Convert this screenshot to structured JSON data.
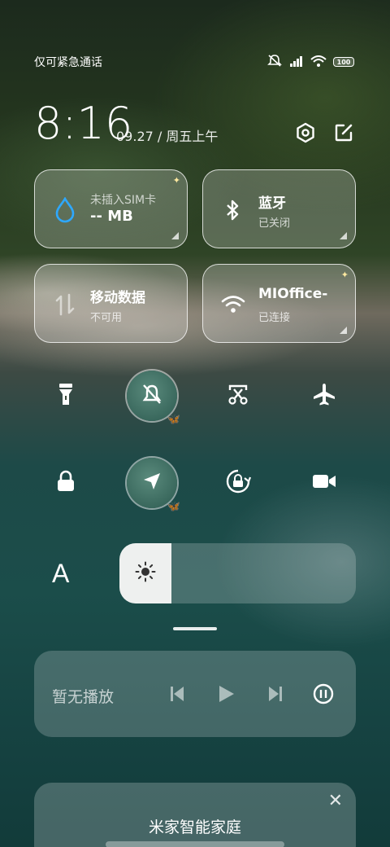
{
  "status_bar": {
    "carrier_text": "仅可紧急通话",
    "battery_level": "100",
    "icons": [
      "silent-icon",
      "signal-icon",
      "wifi-icon",
      "battery-icon"
    ]
  },
  "header": {
    "time": "8:16",
    "date": "09.27 / 周五上午",
    "settings_icon": "gear-icon",
    "edit_icon": "edit-icon"
  },
  "tiles": [
    {
      "title": "未插入SIM卡",
      "subtitle": "-- MB",
      "icon": "water-drop-icon"
    },
    {
      "title": "蓝牙",
      "subtitle": "已关闭",
      "icon": "bluetooth-icon"
    },
    {
      "title": "移动数据",
      "subtitle": "不可用",
      "icon": "mobile-data-icon"
    },
    {
      "title": "MIOffice-",
      "subtitle": "已连接",
      "icon": "wifi-icon"
    }
  ],
  "quick_toggles": [
    {
      "name": "flashlight",
      "icon": "flashlight-icon",
      "active": false
    },
    {
      "name": "mute",
      "icon": "bell-off-icon",
      "active": true
    },
    {
      "name": "screenshot",
      "icon": "scissors-icon",
      "active": false
    },
    {
      "name": "airplane-mode",
      "icon": "airplane-icon",
      "active": false
    },
    {
      "name": "lock-screen",
      "icon": "lock-icon",
      "active": false
    },
    {
      "name": "location",
      "icon": "location-arrow-icon",
      "active": true
    },
    {
      "name": "rotation-lock",
      "icon": "rotation-lock-icon",
      "active": false
    },
    {
      "name": "screen-record",
      "icon": "video-camera-icon",
      "active": false
    }
  ],
  "display": {
    "font_label": "A",
    "brightness_level": 0.22
  },
  "media": {
    "label": "暂无播放"
  },
  "mijia": {
    "title": "米家智能家庭",
    "close": "✕"
  },
  "colors": {
    "accent_blue": "#2ea8ff",
    "active_toggle": "#3f6f63"
  }
}
